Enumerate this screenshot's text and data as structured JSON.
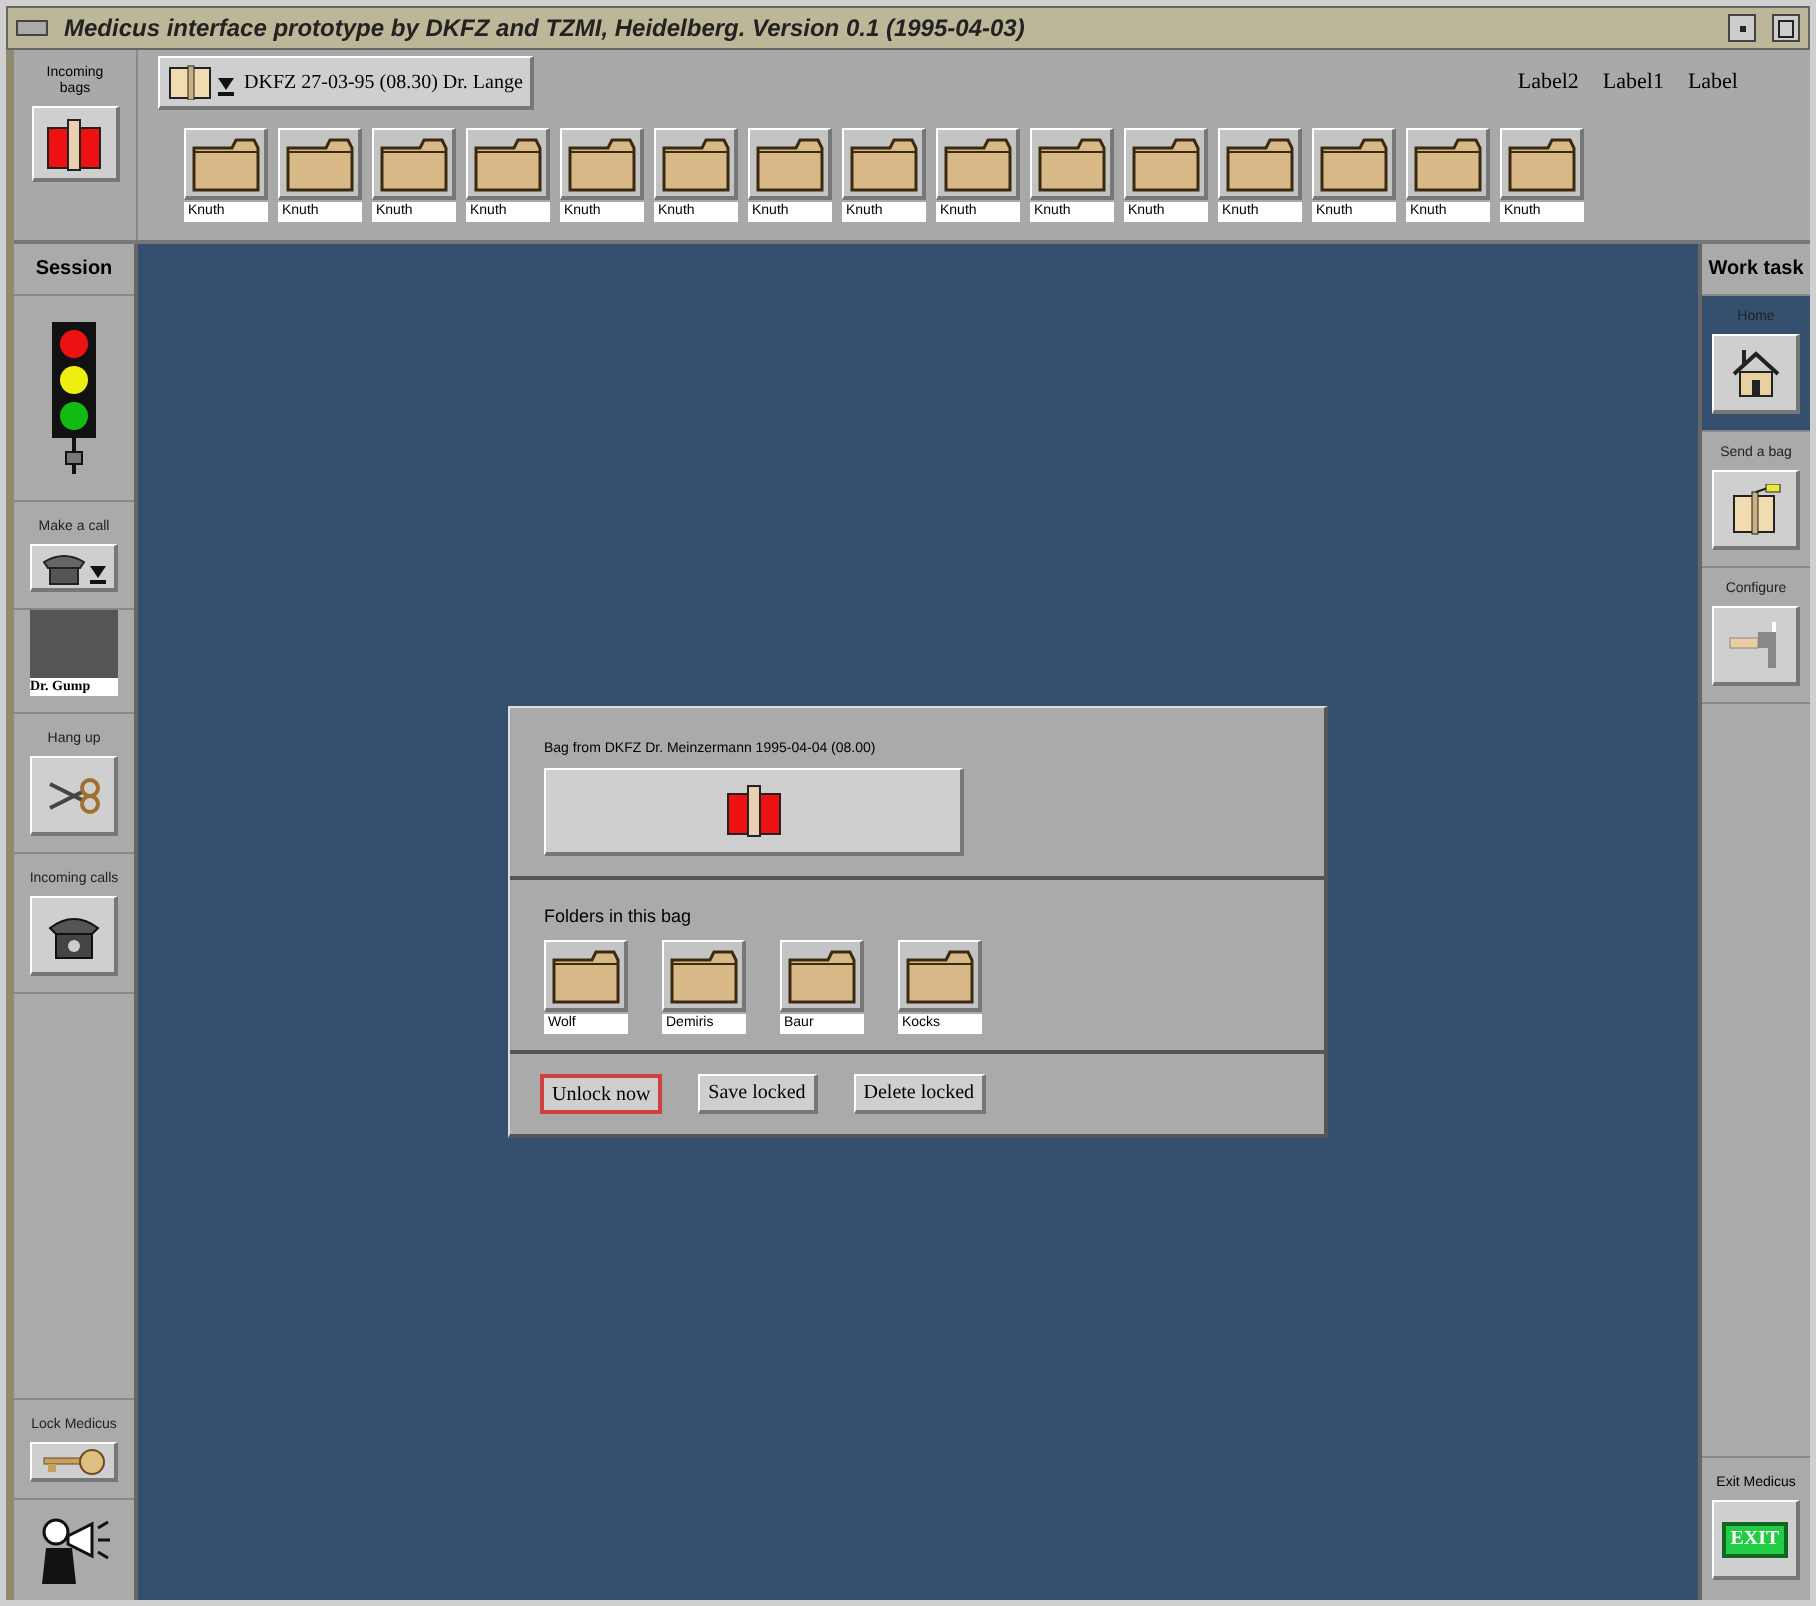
{
  "window": {
    "title": "Medicus interface prototype by DKFZ and TZMI, Heidelberg. Version 0.1 (1995-04-03)"
  },
  "incoming_bags": {
    "label": "Incoming bags"
  },
  "bag_selector": {
    "label": "DKFZ 27-03-95 (08.30) Dr. Lange"
  },
  "labels": [
    "Label2",
    "Label1",
    "Label"
  ],
  "folders": [
    "Knuth",
    "Knuth",
    "Knuth",
    "Knuth",
    "Knuth",
    "Knuth",
    "Knuth",
    "Knuth",
    "Knuth",
    "Knuth",
    "Knuth",
    "Knuth",
    "Knuth",
    "Knuth",
    "Knuth"
  ],
  "session": {
    "title": "Session",
    "items": [
      {
        "kind": "signal"
      },
      {
        "kind": "make_call",
        "label": "Make a call"
      },
      {
        "kind": "contact",
        "label": "Dr. Gump"
      },
      {
        "kind": "hang_up",
        "label": "Hang up"
      },
      {
        "kind": "incoming_calls",
        "label": "Incoming calls"
      },
      {
        "kind": "lock",
        "label": "Lock Medicus"
      },
      {
        "kind": "announce"
      }
    ]
  },
  "work_task": {
    "title": "Work task",
    "items": [
      {
        "kind": "home",
        "label": "Home",
        "selected": true
      },
      {
        "kind": "send",
        "label": "Send a bag",
        "selected": false
      },
      {
        "kind": "configure",
        "label": "Configure",
        "selected": false
      }
    ],
    "exit": {
      "label": "Exit Medicus",
      "button": "EXIT"
    }
  },
  "dialog": {
    "bag_label": "Bag from DKFZ Dr. Meinzermann 1995-04-04 (08.00)",
    "folders_label": "Folders in this bag",
    "folders": [
      "Wolf",
      "Demiris",
      "Baur",
      "Kocks"
    ],
    "buttons": [
      {
        "label": "Unlock now",
        "focused": true
      },
      {
        "label": "Save locked",
        "focused": false
      },
      {
        "label": "Delete locked",
        "focused": false
      }
    ]
  }
}
